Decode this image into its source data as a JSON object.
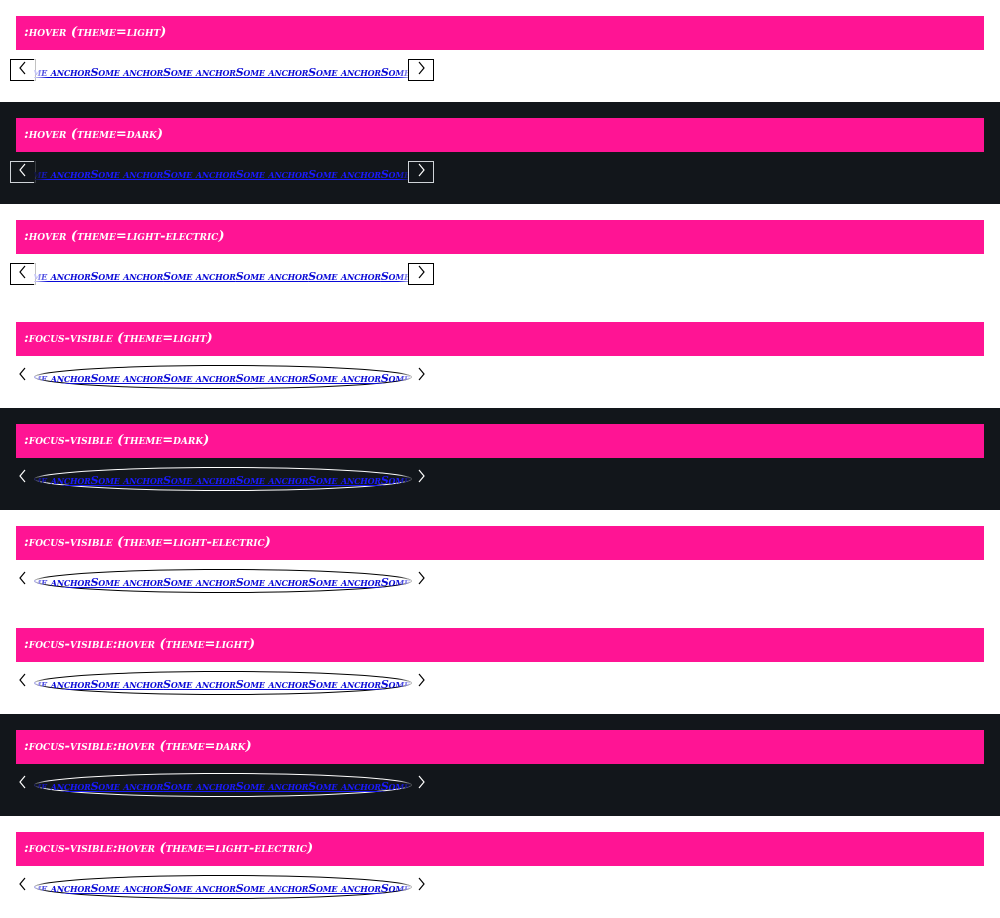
{
  "sections": [
    {
      "title": ":hover (theme=light)",
      "theme": "light",
      "variant": "hover"
    },
    {
      "title": ":hover (theme=dark)",
      "theme": "dark",
      "variant": "hover"
    },
    {
      "title": ":hover (theme=light-electric)",
      "theme": "light-electric",
      "variant": "hover"
    },
    {
      "title": ":focus-visible (theme=light)",
      "theme": "light",
      "variant": "focus"
    },
    {
      "title": ":focus-visible (theme=dark)",
      "theme": "dark",
      "variant": "focus"
    },
    {
      "title": ":focus-visible (theme=light-electric)",
      "theme": "light-electric",
      "variant": "focus"
    },
    {
      "title": ":focus-visible:hover (theme=light)",
      "theme": "light",
      "variant": "focus"
    },
    {
      "title": ":focus-visible:hover (theme=dark)",
      "theme": "dark",
      "variant": "focus"
    },
    {
      "title": ":focus-visible:hover (theme=light-electric)",
      "theme": "light-electric",
      "variant": "focus"
    }
  ],
  "anchor_text": "Some anchor",
  "anchor_count": 7,
  "icons": {
    "prev": "chevron-left-icon",
    "next": "chevron-right-icon"
  },
  "colors": {
    "banner": "#ff1494",
    "banner_text": "#ffffff",
    "dark_background": "#12161b",
    "light_background": "#ffffff",
    "anchor": "#0a0ad6"
  }
}
